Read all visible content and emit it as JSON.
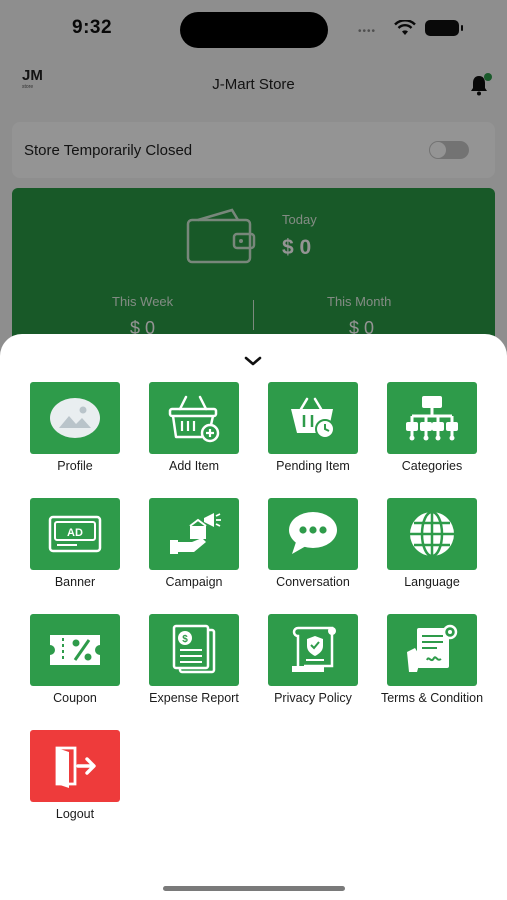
{
  "status_bar": {
    "time": "9:32"
  },
  "header": {
    "logo_text": "JM",
    "logo_sub": "store",
    "title": "J-Mart Store"
  },
  "store_status": {
    "label": "Store Temporarily Closed",
    "toggle_on": false
  },
  "earnings": {
    "today_label": "Today",
    "today_value": "$ 0",
    "week_label": "This Week",
    "week_value": "$ 0",
    "month_label": "This Month",
    "month_value": "$ 0"
  },
  "menu": {
    "items": [
      {
        "label": "Profile",
        "icon": "profile-image-icon"
      },
      {
        "label": "Add Item",
        "icon": "basket-add-icon"
      },
      {
        "label": "Pending Item",
        "icon": "basket-clock-icon"
      },
      {
        "label": "Categories",
        "icon": "hierarchy-icon"
      },
      {
        "label": "Banner",
        "icon": "ad-banner-icon"
      },
      {
        "label": "Campaign",
        "icon": "campaign-icon"
      },
      {
        "label": "Conversation",
        "icon": "chat-bubble-icon"
      },
      {
        "label": "Language",
        "icon": "globe-icon"
      },
      {
        "label": "Coupon",
        "icon": "coupon-icon"
      },
      {
        "label": "Expense Report",
        "icon": "expense-report-icon"
      },
      {
        "label": "Privacy Policy",
        "icon": "privacy-policy-icon"
      },
      {
        "label": "Terms & Condition",
        "icon": "terms-icon"
      },
      {
        "label": "Logout",
        "icon": "logout-icon"
      }
    ]
  },
  "colors": {
    "primary": "#2e9b4a",
    "danger": "#ee3b3b"
  }
}
